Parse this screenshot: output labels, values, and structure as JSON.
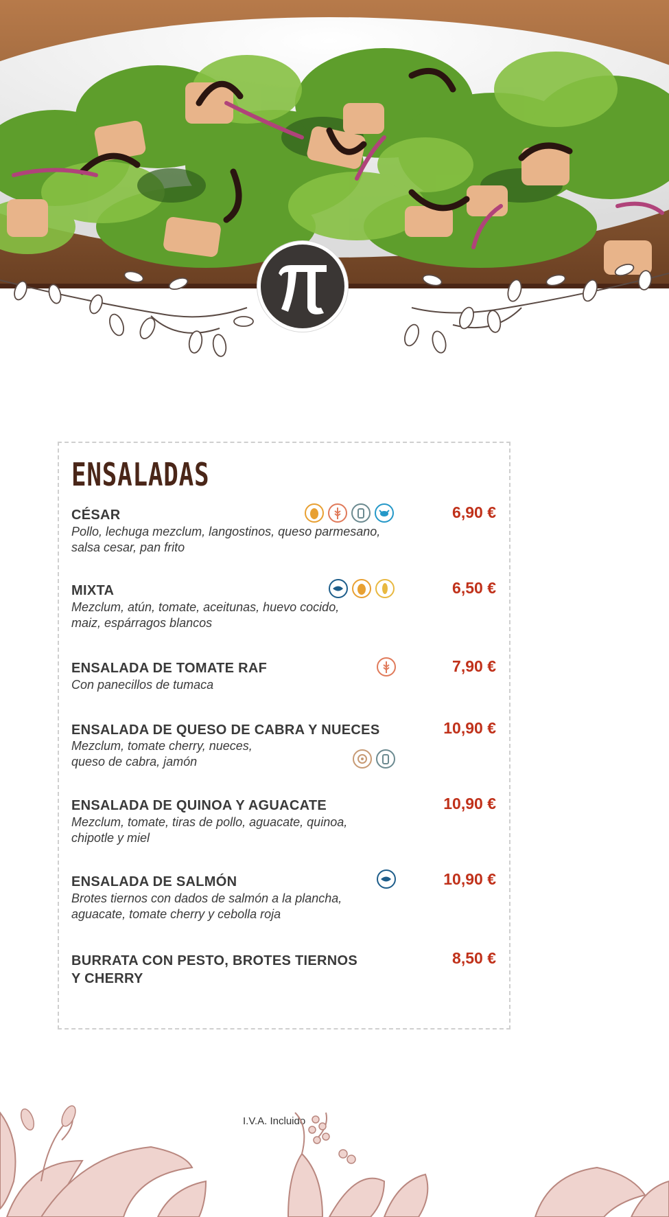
{
  "logo": {
    "icon": "pi-icon"
  },
  "section_title": "ENSALADAS",
  "items": [
    {
      "name": "CÉSAR",
      "description": "Pollo, lechuga mezclum, langostinos, queso parmesano,\nsalsa cesar, pan frito",
      "price": "6,90 €",
      "allergens": [
        "egg-icon",
        "gluten-icon",
        "milk-icon",
        "crustacean-icon"
      ]
    },
    {
      "name": "MIXTA",
      "description": "Mezclum, atún, tomate, aceitunas, huevo cocido,\nmaiz, espárragos blancos",
      "price": "6,50 €",
      "allergens": [
        "fish-icon",
        "egg-icon",
        "corn-icon"
      ]
    },
    {
      "name": "ENSALADA DE TOMATE RAF",
      "description": "Con panecillos de tumaca",
      "price": "7,90 €",
      "allergens": [
        "gluten-icon"
      ]
    },
    {
      "name": "ENSALADA DE QUESO DE CABRA Y NUECES",
      "description": "Mezclum, tomate cherry, nueces,\nqueso de cabra, jamón",
      "price": "10,90 €",
      "allergens": [
        "nuts-icon",
        "milk-icon"
      ]
    },
    {
      "name": "ENSALADA DE QUINOA Y AGUACATE",
      "description": "Mezclum, tomate, tiras de pollo, aguacate, quinoa,\nchipotle y miel",
      "price": "10,90 €",
      "allergens": []
    },
    {
      "name": "ENSALADA DE SALMÓN",
      "description": "Brotes tiernos con dados de salmón a la plancha,\naguacate, tomate cherry y cebolla roja",
      "price": "10,90 €",
      "allergens": [
        "fish-icon"
      ]
    },
    {
      "name": "BURRATA CON PESTO, BROTES TIERNOS\nY CHERRY",
      "description": "",
      "price": "8,50 €",
      "allergens": []
    }
  ],
  "footer_note": "I.V.A. Incluido",
  "colors": {
    "price": "#c0311a",
    "title": "#4a2618",
    "band": "#4a2616",
    "floral": "#e9c9c4"
  }
}
